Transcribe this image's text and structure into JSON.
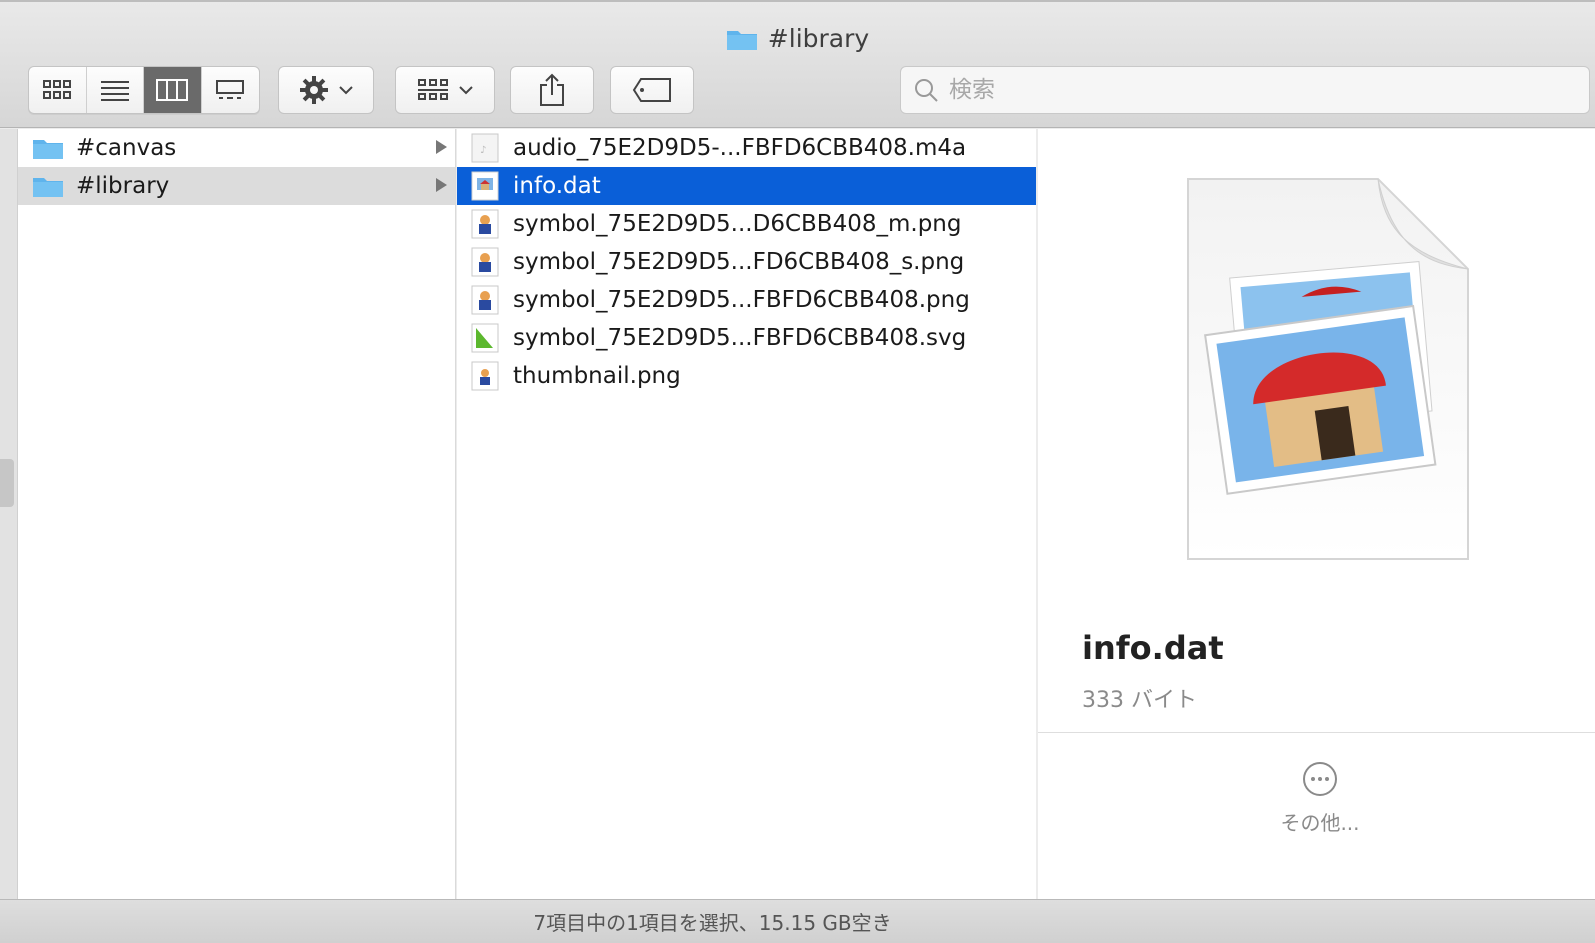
{
  "window": {
    "title": "#library"
  },
  "toolbar": {
    "view_modes": [
      "icon-view",
      "list-view",
      "column-view",
      "gallery-view"
    ],
    "active_view": "column-view",
    "search_placeholder": "検索"
  },
  "column1": {
    "items": [
      {
        "label": "#canvas",
        "type": "folder",
        "selected": false
      },
      {
        "label": "#library",
        "type": "folder",
        "selected": true
      }
    ]
  },
  "column2": {
    "items": [
      {
        "label": "audio_75E2D9D5-...FBFD6CBB408.m4a",
        "icon": "audio-file-icon",
        "selected": false
      },
      {
        "label": "info.dat",
        "icon": "dat-file-icon",
        "selected": true
      },
      {
        "label": "symbol_75E2D9D5...D6CBB408_m.png",
        "icon": "png-file-icon",
        "selected": false
      },
      {
        "label": "symbol_75E2D9D5...FD6CBB408_s.png",
        "icon": "png-file-icon",
        "selected": false
      },
      {
        "label": "symbol_75E2D9D5...FBFD6CBB408.png",
        "icon": "png-file-icon",
        "selected": false
      },
      {
        "label": "symbol_75E2D9D5...FBFD6CBB408.svg",
        "icon": "svg-file-icon",
        "selected": false
      },
      {
        "label": "thumbnail.png",
        "icon": "png-file-icon",
        "selected": false
      }
    ]
  },
  "preview": {
    "name": "info.dat",
    "size": "333 バイト",
    "more_label": "その他..."
  },
  "status": {
    "text": "7項目中の1項目を選択、15.15 GB空き"
  },
  "colors": {
    "selection": "#0a5fd8",
    "folder": "#5fb4ec"
  }
}
